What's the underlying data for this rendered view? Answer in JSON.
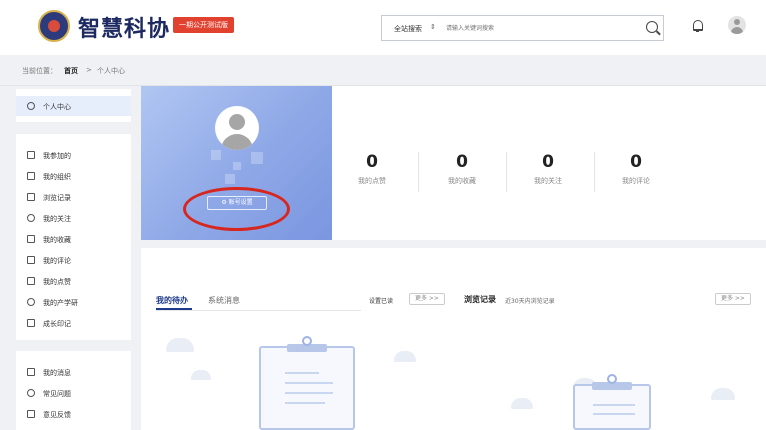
{
  "header": {
    "brand": "智慧科协",
    "badge": "一期公开测试版",
    "search": {
      "scope": "全站搜索",
      "scope_arrow": "⇕",
      "placeholder": "请输入关键词搜索"
    }
  },
  "breadcrumb": {
    "prefix": "当前位置：",
    "home": "首页",
    "sep": ">",
    "current": "个人中心"
  },
  "sidebar": {
    "group1": [
      {
        "label": "个人中心",
        "icon": "smile-icon",
        "active": true
      }
    ],
    "group2": [
      {
        "label": "我参加的",
        "icon": "calendar-icon"
      },
      {
        "label": "我的组织",
        "icon": "organization-icon"
      },
      {
        "label": "浏览记录",
        "icon": "history-icon"
      },
      {
        "label": "我的关注",
        "icon": "focus-icon"
      },
      {
        "label": "我的收藏",
        "icon": "bookmark-icon"
      },
      {
        "label": "我的评论",
        "icon": "comment-icon"
      },
      {
        "label": "我的点赞",
        "icon": "thumbs-up-icon"
      },
      {
        "label": "我的产学研",
        "icon": "research-icon"
      },
      {
        "label": "成长印记",
        "icon": "growth-icon"
      }
    ],
    "group3": [
      {
        "label": "我的消息",
        "icon": "message-icon"
      },
      {
        "label": "常见问题",
        "icon": "question-icon"
      },
      {
        "label": "意见反馈",
        "icon": "feedback-icon"
      }
    ]
  },
  "profile": {
    "account_settings": "⚙ 账号设置"
  },
  "stats": [
    {
      "value": "0",
      "label": "我的点赞"
    },
    {
      "value": "0",
      "label": "我的收藏"
    },
    {
      "value": "0",
      "label": "我的关注"
    },
    {
      "value": "0",
      "label": "我的评论"
    }
  ],
  "lower": {
    "tabs": [
      "我的待办",
      "系统消息"
    ],
    "mark_read": "设置已读",
    "more1": "更多 >>",
    "browse_title": "浏览记录",
    "browse_sub": "近30天内浏览记录",
    "more2": "更多 >>"
  },
  "colors": {
    "accent": "#1f3a8a",
    "badge": "#e1412f",
    "highlight_circle": "#d7261d",
    "card_gradient": "#8ea8e7"
  }
}
